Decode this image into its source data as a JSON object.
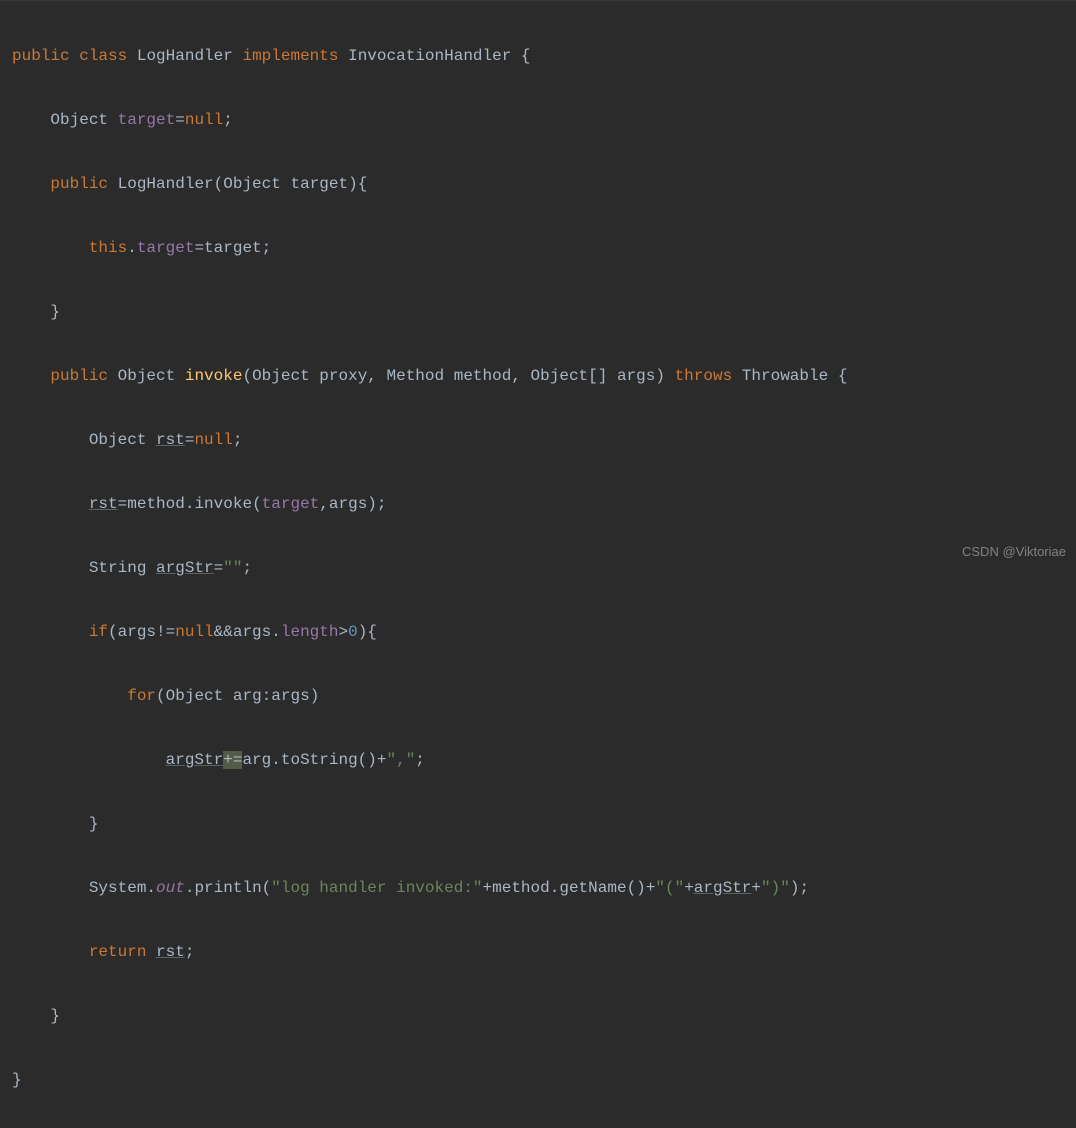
{
  "code": {
    "line1": {
      "kw_public": "public",
      "kw_class": "class",
      "classname": "LogHandler",
      "kw_implements": "implements",
      "iface": "InvocationHandler",
      "brace": " {"
    },
    "line2": {
      "type": "Object",
      "field": "target",
      "eq": "=",
      "nullkw": "null",
      "semi": ";"
    },
    "line3": {
      "kw_public": "public",
      "ctor": "LogHandler",
      "paren_open": "(",
      "ptype": "Object",
      "pname": "target",
      "paren_close": ")",
      "brace": "{"
    },
    "line4": {
      "thiskw": "this",
      "dot": ".",
      "field": "target",
      "eq": "=",
      "param": "target",
      "semi": ";"
    },
    "line5": {
      "brace": "}"
    },
    "line6": {
      "kw_public": "public",
      "rettype": "Object",
      "method": "invoke",
      "paren_open": "(",
      "p1type": "Object",
      "p1name": "proxy",
      "comma1": ", ",
      "p2type": "Method",
      "p2name": "method",
      "comma2": ", ",
      "p3type": "Object[]",
      "p3name": "args",
      "paren_close": ")",
      "kw_throws": "throws",
      "exc": "Throwable",
      "brace": " {"
    },
    "line7": {
      "type": "Object",
      "var": "rst",
      "eq": "=",
      "nullkw": "null",
      "semi": ";"
    },
    "line8": {
      "var": "rst",
      "eq": "=",
      "obj": "method",
      "dot": ".",
      "call": "invoke",
      "paren_open": "(",
      "arg1": "target",
      "comma": ",",
      "arg2": "args",
      "paren_close": ")",
      "semi": ";"
    },
    "line9": {
      "type": "String",
      "var": "argStr",
      "eq": "=",
      "str": "\"\"",
      "semi": ";"
    },
    "line10": {
      "kw_if": "if",
      "paren_open": "(",
      "arg": "args",
      "neq": "!=",
      "nullkw": "null",
      "and": "&&",
      "arg2": "args",
      "dot": ".",
      "prop": "length",
      "gt": ">",
      "num": "0",
      "paren_close": ")",
      "brace": "{"
    },
    "line11": {
      "kw_for": "for",
      "paren_open": "(",
      "type": "Object",
      "var": "arg",
      "colon": ":",
      "iter": "args",
      "paren_close": ")"
    },
    "line12": {
      "var": "argStr",
      "pluseq": "+=",
      "obj": "arg",
      "dot": ".",
      "call": "toString",
      "parens": "()",
      "plus": "+",
      "str": "\",\"",
      "semi": ";"
    },
    "line13": {
      "brace": "}"
    },
    "line14": {
      "cls": "System",
      "dot1": ".",
      "out": "out",
      "dot2": ".",
      "call": "println",
      "paren_open": "(",
      "str1": "\"log handler invoked:\"",
      "plus1": "+",
      "obj": "method",
      "dot3": ".",
      "call2": "getName",
      "parens": "()",
      "plus2": "+",
      "str2": "\"(\"",
      "plus3": "+",
      "var": "argStr",
      "plus4": "+",
      "str3": "\")\"",
      "paren_close": ")",
      "semi": ";"
    },
    "line15": {
      "kw_return": "return",
      "var": "rst",
      "semi": ";"
    },
    "line16": {
      "brace": "}"
    },
    "line17": {
      "brace": "}"
    }
  },
  "watermark": "CSDN @Viktoriae"
}
